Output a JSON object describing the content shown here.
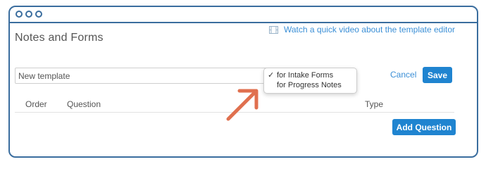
{
  "page": {
    "title": "Notes and Forms"
  },
  "video_link": {
    "label": "Watch a quick video about the template editor",
    "icon": "film-icon"
  },
  "template_name": {
    "value": "New template"
  },
  "template_type_dropdown": {
    "options": [
      {
        "label": "for Intake Forms",
        "checked": true
      },
      {
        "label": "for Progress Notes",
        "checked": false
      }
    ],
    "check_glyph": "✓"
  },
  "actions": {
    "cancel_label": "Cancel",
    "save_label": "Save",
    "add_question_label": "Add Question"
  },
  "table": {
    "headers": [
      "Order",
      "Question",
      "Type"
    ]
  },
  "colors": {
    "accent": "#1f84d0",
    "link": "#3b8fd6",
    "frame": "#3a6d9e",
    "annotation_arrow": "#e0704f"
  }
}
